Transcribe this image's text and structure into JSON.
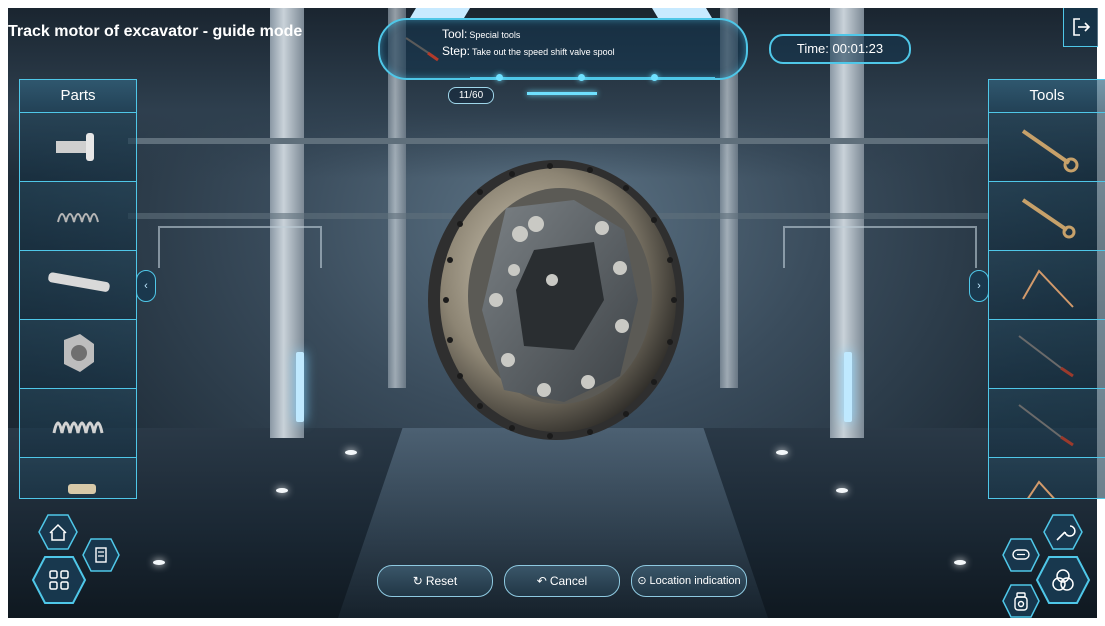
{
  "title": "Track motor of excavator - guide mode",
  "info": {
    "tool_label": "Tool:",
    "tool_value": "Special tools",
    "step_label": "Step:",
    "step_value": "Take out the speed shift valve spool",
    "progress": "11/60"
  },
  "timer": {
    "label": "Time:",
    "value": "00:01:23"
  },
  "parts_panel": {
    "title": "Parts",
    "items": [
      "flanged-pin-icon",
      "small-spring-icon",
      "shaft-pin-icon",
      "hex-nut-icon",
      "coil-spring-icon",
      "bolt-icon"
    ]
  },
  "tools_panel": {
    "title": "Tools",
    "items": [
      "wrench-icon",
      "wrench-icon",
      "hex-key-icon",
      "screwdriver-icon",
      "screwdriver-icon",
      "hex-key-icon"
    ]
  },
  "bottom_buttons": {
    "reset": "Reset",
    "cancel": "Cancel",
    "location": "Location indication"
  },
  "colors": {
    "accent": "#4fc7e8",
    "panel": "#19374b"
  }
}
